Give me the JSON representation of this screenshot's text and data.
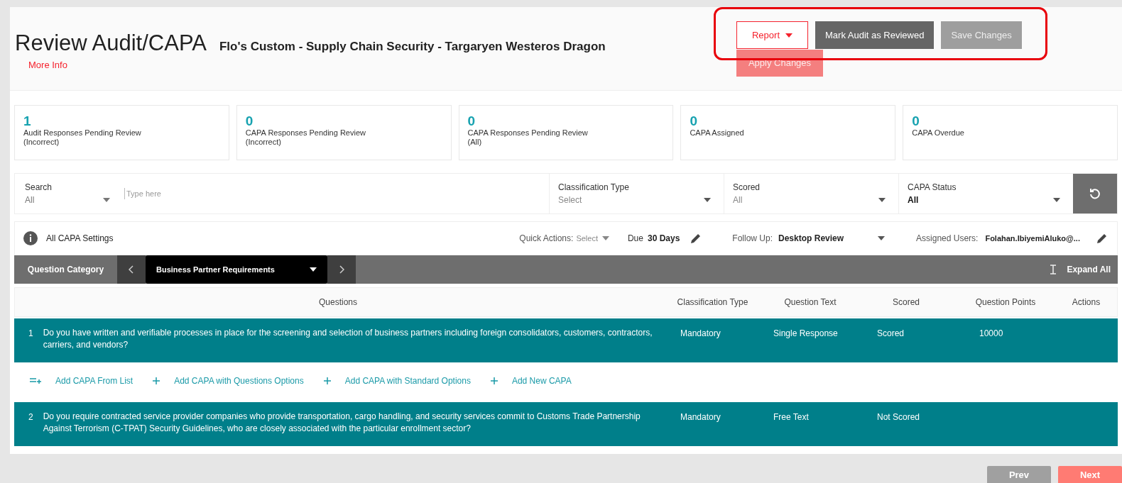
{
  "header": {
    "title": "Review Audit/CAPA",
    "subtitle": "Flo's Custom - Supply Chain Security - Targaryen Westeros Dragon",
    "more_info": "More Info",
    "buttons": [
      {
        "label": "Report",
        "kind": "dropdown"
      },
      {
        "label": "Mark Audit as Reviewed",
        "kind": "dark"
      },
      {
        "label": "Save Changes",
        "kind": "disabled"
      }
    ],
    "apply_button": "Apply Changes"
  },
  "stats": [
    {
      "value": "1",
      "label": "Audit Responses Pending Review\n(Incorrect)"
    },
    {
      "value": "0",
      "label": "CAPA Responses Pending Review\n(Incorrect)"
    },
    {
      "value": "0",
      "label": "CAPA Responses Pending Review\n(All)"
    },
    {
      "value": "0",
      "label": "CAPA Assigned"
    },
    {
      "value": "0",
      "label": "CAPA Overdue"
    }
  ],
  "filters": {
    "search": {
      "label": "Search",
      "value": "All",
      "placeholder": "Type here"
    },
    "dropdowns": [
      {
        "label": "Classification Type",
        "value": "Select",
        "muted": true
      },
      {
        "label": "Scored",
        "value": "All",
        "muted": true
      },
      {
        "label": "CAPA Status",
        "value": "All",
        "muted": false
      }
    ]
  },
  "settings": {
    "label": "All CAPA Settings",
    "quick_actions_label": "Quick Actions:",
    "quick_actions_value": "Select",
    "due_label": "Due",
    "due_value": "30 Days",
    "follow_up_label": "Follow Up:",
    "follow_up_value": "Desktop Review",
    "assigned_label": "Assigned Users:",
    "assigned_value": "Folahan.IbiyemiAluko@..."
  },
  "category": {
    "label": "Question Category",
    "selected": "Business Partner Requirements",
    "expand_all": "Expand All"
  },
  "table": {
    "columns": [
      "Questions",
      "Classification Type",
      "Question Text",
      "Scored",
      "Question Points",
      "Actions"
    ],
    "rows": [
      {
        "number": "1",
        "question": "Do you have written and verifiable processes in place for the screening and selection of business partners including foreign consolidators, customers, contractors, carriers, and vendors?",
        "classification": "Mandatory",
        "question_text": "Single Response",
        "scored": "Scored",
        "points": "10000",
        "actions": [
          {
            "label": "Add CAPA From List",
            "kind": "list"
          },
          {
            "label": "Add CAPA with Questions Options",
            "kind": "plus"
          },
          {
            "label": "Add CAPA with Standard Options",
            "kind": "plus"
          },
          {
            "label": "Add New CAPA",
            "kind": "plus"
          }
        ]
      },
      {
        "number": "2",
        "question": "Do you require contracted service provider companies who provide transportation, cargo handling, and security services commit to Customs Trade Partnership Against Terrorism (C-TPAT) Security Guidelines, who are closely associated with the particular enrollment sector?",
        "classification": "Mandatory",
        "question_text": "Free Text",
        "scored": "Not Scored"
      }
    ]
  },
  "pager": {
    "prev": "Prev",
    "next": "Next"
  }
}
